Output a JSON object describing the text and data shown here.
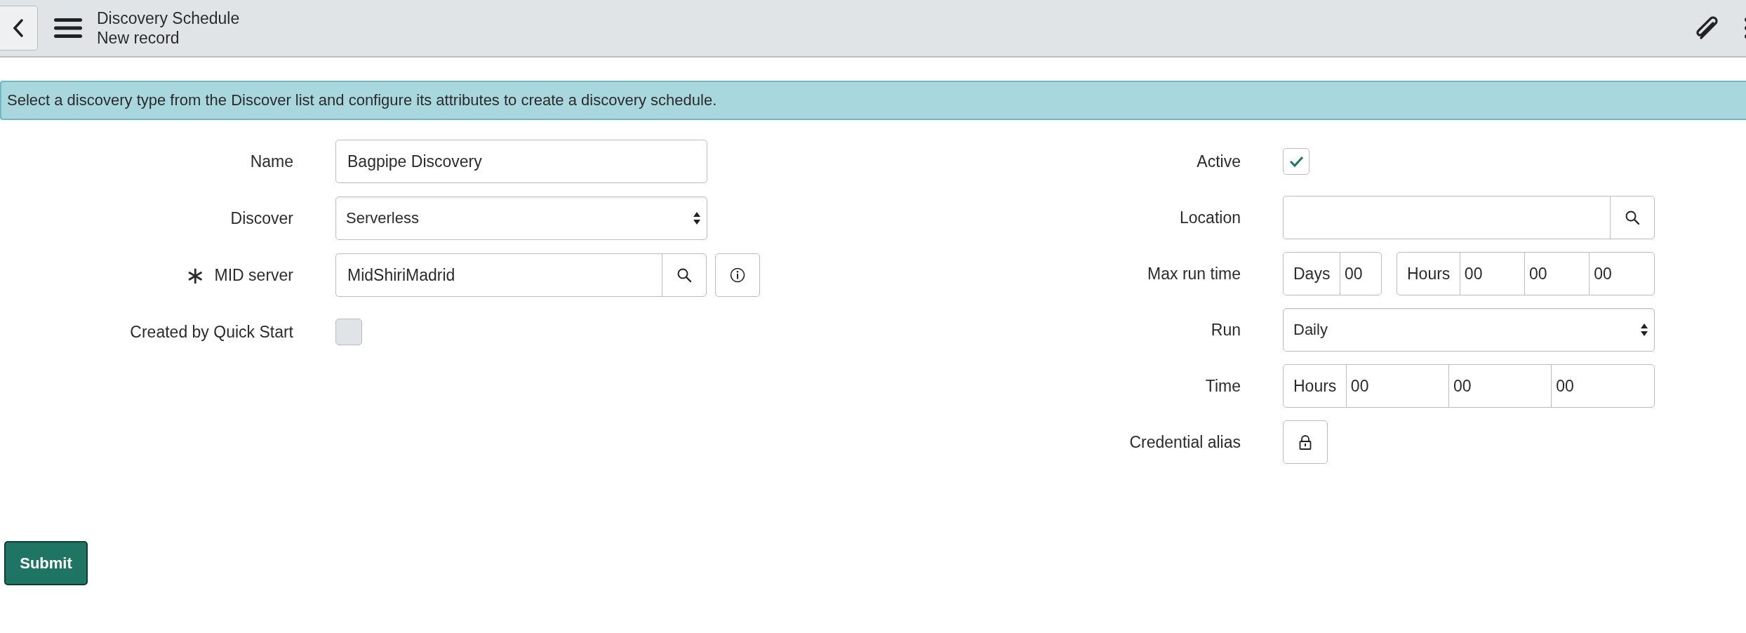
{
  "header": {
    "title": "Discovery Schedule",
    "subtitle": "New record"
  },
  "banner": {
    "text": "Select a discovery type from the Discover list and configure its attributes to create a discovery schedule."
  },
  "left_fields": [
    {
      "label": "Name",
      "kind": "text",
      "value": "Bagpipe Discovery"
    },
    {
      "label": "Discover",
      "kind": "select",
      "value": "Serverless"
    },
    {
      "label": "MID server",
      "kind": "reference_info",
      "required_mark": "∗",
      "value": "MidShiriMadrid"
    },
    {
      "label": "Created by Quick Start",
      "kind": "checkbox",
      "checked": false,
      "disabled": true
    }
  ],
  "right_fields": [
    {
      "label": "Active",
      "kind": "checkbox",
      "checked": true,
      "disabled": false
    },
    {
      "label": "Location",
      "kind": "reference"
    },
    {
      "label": "Max run time",
      "kind": "duration",
      "days_label": "Days",
      "days": "00",
      "hours_label": "Hours",
      "parts": [
        "00",
        "00",
        "00"
      ]
    },
    {
      "label": "Run",
      "kind": "select",
      "value": "Daily"
    },
    {
      "label": "Time",
      "kind": "time",
      "hours_label": "Hours",
      "parts": [
        "00",
        "00",
        "00"
      ]
    },
    {
      "label": "Credential alias",
      "kind": "lock"
    }
  ],
  "submit": {
    "label": "Submit"
  }
}
